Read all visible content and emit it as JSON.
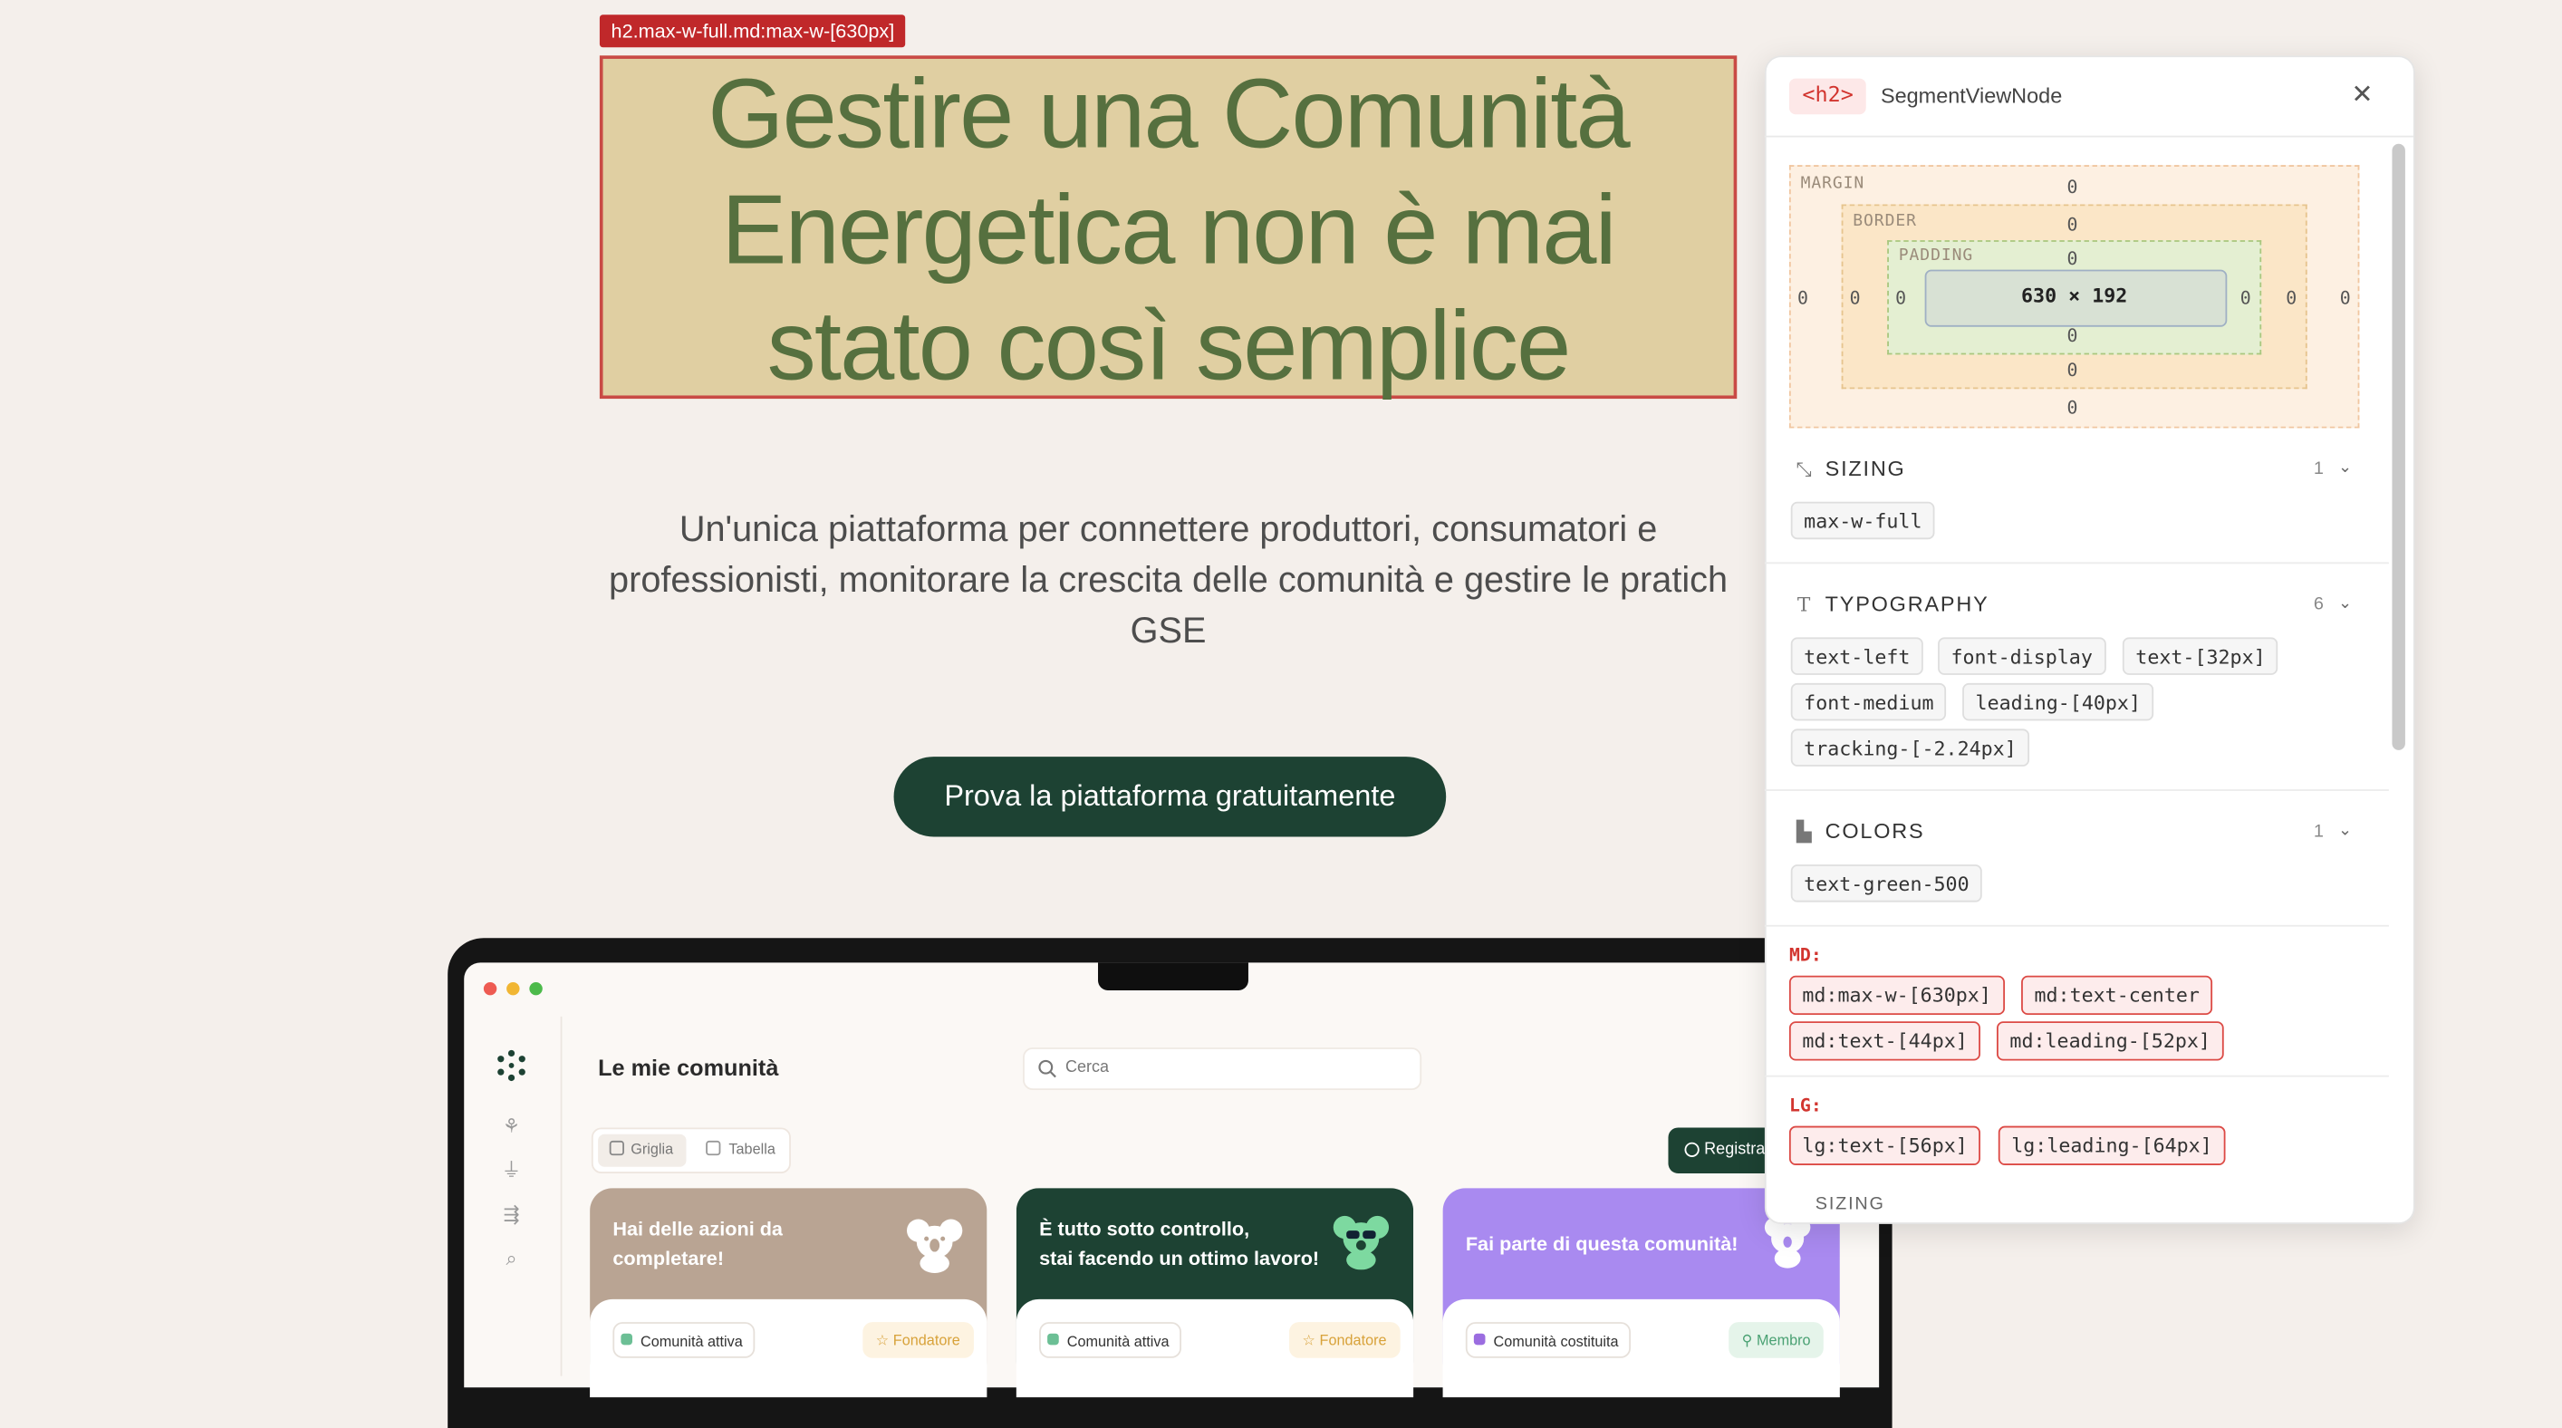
{
  "inspector_tag": "h2.max-w-full.md:max-w-[630px]",
  "hero": {
    "title_lines": [
      "Gestire una Comunità",
      "Energetica non è mai",
      "stato così semplice"
    ],
    "subtitle_lines": [
      "Un'unica piattaforma per connettere produttori, consumatori e",
      "professionisti, monitorare la crescita delle comunità e gestire le pratich",
      "GSE"
    ],
    "cta_label": "Prova la piattaforma gratuitamente"
  },
  "app": {
    "title": "Le mie comunità",
    "search_placeholder": "Cerca",
    "view_tabs": [
      "Griglia",
      "Tabella"
    ],
    "register_label": "Registra",
    "cards": [
      {
        "headline": [
          "Hai delle azioni da",
          "completare!"
        ],
        "status": "Comunità attiva",
        "role": "Fondatore",
        "head_color": "#b9a493",
        "status_color": "#6cbf95",
        "role_color": "#e6a93a"
      },
      {
        "headline": [
          "È tutto sotto controllo,",
          "stai facendo un ottimo lavoro!"
        ],
        "status": "Comunità attiva",
        "role": "Fondatore",
        "head_color": "#1d4233",
        "status_color": "#6cbf95",
        "role_color": "#e6a93a"
      },
      {
        "headline": [
          "Fai parte di questa comunità!"
        ],
        "status": "Comunità costituita",
        "role": "Membro",
        "head_color": "#a98af0",
        "status_color": "#9b6de0",
        "role_color": "#5bb087"
      }
    ]
  },
  "panel": {
    "element_tag": "<h2>",
    "node_name": "SegmentViewNode",
    "box_model": {
      "margin_label": "MARGIN",
      "border_label": "BORDER",
      "padding_label": "PADDING",
      "margin": "0",
      "border": "0",
      "padding": "0",
      "content": "630 × 192"
    },
    "sections": [
      {
        "title": "SIZING",
        "count": "1",
        "chips": [
          "max-w-full"
        ]
      },
      {
        "title": "TYPOGRAPHY",
        "count": "6",
        "chips": [
          "text-left",
          "font-display",
          "text-[32px]",
          "font-medium",
          "leading-[40px]",
          "tracking-[-2.24px]"
        ]
      },
      {
        "title": "COLORS",
        "count": "1",
        "chips": [
          "text-green-500"
        ]
      }
    ],
    "breakpoints": [
      {
        "label": "MD:",
        "chips": [
          "md:max-w-[630px]",
          "md:text-center",
          "md:text-[44px]",
          "md:leading-[52px]"
        ]
      },
      {
        "label": "LG:",
        "chips": [
          "lg:text-[56px]",
          "lg:leading-[64px]"
        ]
      }
    ],
    "trailing_label": "SIZING"
  },
  "colors": {
    "brand_green": "#1d4233",
    "title_green": "#56703f",
    "inspector_red": "#d2352f"
  }
}
